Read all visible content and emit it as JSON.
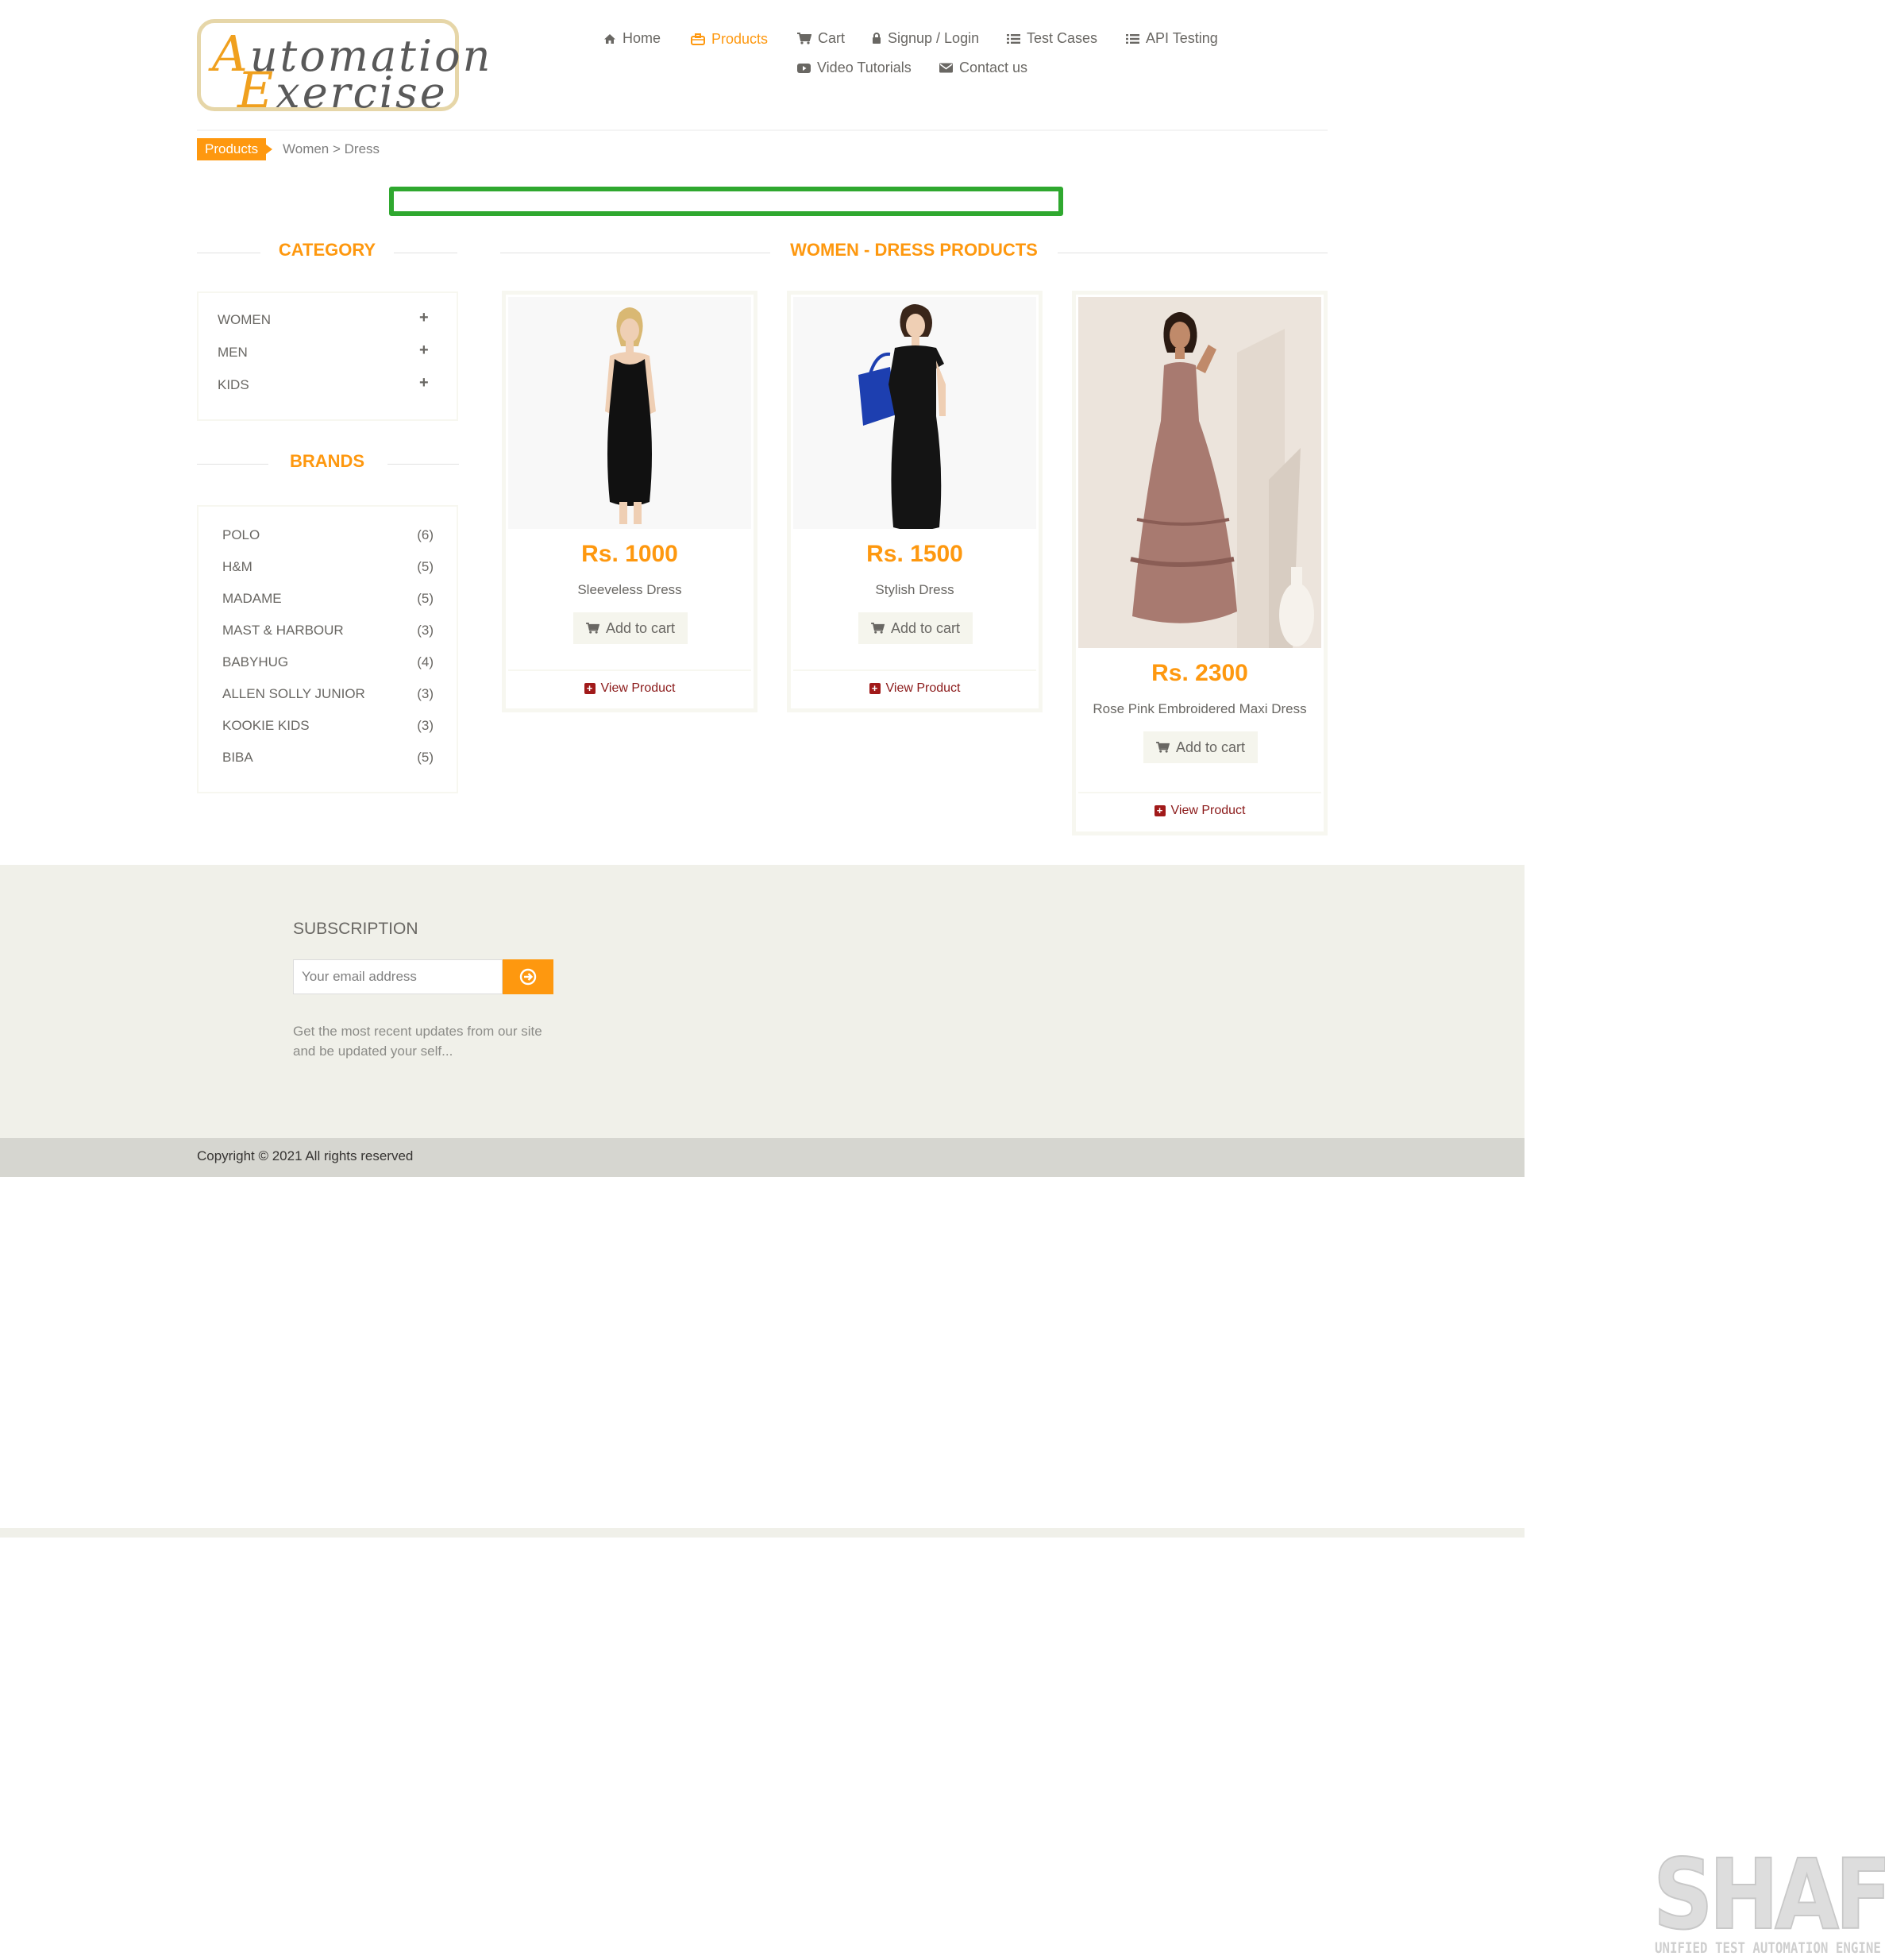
{
  "logo": {
    "line1_cap": "A",
    "line1_rest": "utomation",
    "line2_cap": "E",
    "line2_rest": "xercise"
  },
  "nav": [
    {
      "label": "Home",
      "icon": "home-icon"
    },
    {
      "label": "Products",
      "icon": "briefcase-icon",
      "active": true
    },
    {
      "label": "Cart",
      "icon": "cart-icon"
    },
    {
      "label": "Signup / Login",
      "icon": "lock-icon"
    },
    {
      "label": "Test Cases",
      "icon": "list-icon"
    },
    {
      "label": "API Testing",
      "icon": "list-icon"
    },
    {
      "label": "Video Tutorials",
      "icon": "youtube-play-icon"
    },
    {
      "label": "Contact us",
      "icon": "envelope-icon"
    }
  ],
  "breadcrumb": {
    "active": "Products",
    "path": "Women > Dress"
  },
  "sidebar": {
    "category_title": "CATEGORY",
    "categories": [
      {
        "label": "WOMEN",
        "toggle": "+"
      },
      {
        "label": "MEN",
        "toggle": "+"
      },
      {
        "label": "KIDS",
        "toggle": "+"
      }
    ],
    "brands_title": "BRANDS",
    "brands": [
      {
        "name": "POLO",
        "count": "(6)"
      },
      {
        "name": "H&M",
        "count": "(5)"
      },
      {
        "name": "MADAME",
        "count": "(5)"
      },
      {
        "name": "MAST & HARBOUR",
        "count": "(3)"
      },
      {
        "name": "BABYHUG",
        "count": "(4)"
      },
      {
        "name": "ALLEN SOLLY JUNIOR",
        "count": "(3)"
      },
      {
        "name": "KOOKIE KIDS",
        "count": "(3)"
      },
      {
        "name": "BIBA",
        "count": "(5)"
      }
    ]
  },
  "main": {
    "title": "WOMEN - DRESS PRODUCTS",
    "products": [
      {
        "price": "Rs. 1000",
        "name": "Sleeveless Dress",
        "add_to_cart": "Add to cart",
        "view": "View Product",
        "dress_color": "#111111"
      },
      {
        "price": "Rs. 1500",
        "name": "Stylish Dress",
        "add_to_cart": "Add to cart",
        "view": "View Product",
        "dress_color": "#141414"
      },
      {
        "price": "Rs. 2300",
        "name": "Rose Pink Embroidered Maxi Dress",
        "add_to_cart": "Add to cart",
        "view": "View Product",
        "dress_color": "#a87a70"
      }
    ]
  },
  "footer": {
    "subscription_title": "SUBSCRIPTION",
    "email_placeholder": "Your email address",
    "subscription_text": "Get the most recent updates from our site and be updated your self...",
    "copyright": "Copyright © 2021 All rights reserved"
  },
  "watermark": {
    "big": "SHAFT",
    "small": "UNIFIED TEST AUTOMATION ENGINE"
  },
  "colors": {
    "accent": "#FE980F",
    "footer_bg": "#F0F0E9",
    "copyright_bg": "#D6D6D0",
    "view_link": "#8B1A1A"
  }
}
